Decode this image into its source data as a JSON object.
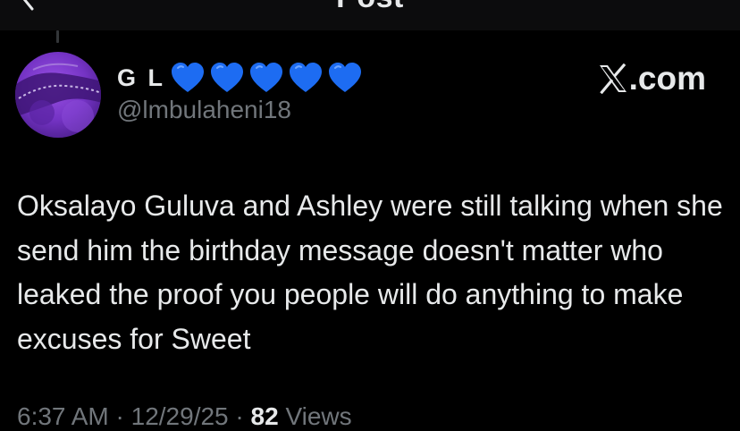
{
  "header": {
    "title": "Post",
    "back_icon": "arrow-left-icon"
  },
  "author": {
    "display_name": "G L",
    "name_emoji": [
      "blue-heart-icon",
      "blue-heart-icon",
      "blue-heart-icon",
      "blue-heart-icon",
      "blue-heart-icon"
    ],
    "handle": "@lmbulaheni18",
    "avatar_icon": "avatar"
  },
  "watermark": {
    "text": ".com",
    "logo_icon": "x-logo-icon"
  },
  "tweet": {
    "text": "Oksalayo Guluva and Ashley were still talking when she send him the birthday message doesn't matter who leaked the proof you people will do anything to make excuses for Sweet"
  },
  "meta": {
    "time": "6:37 AM",
    "separator": " · ",
    "date": "12/29/25",
    "views_count": "82",
    "views_label": " Views"
  },
  "colors": {
    "background": "#000000",
    "text": "#e7e9ea",
    "secondary": "#71767b",
    "heart": "#1d6cf2",
    "avatar": "#7a35c8"
  }
}
